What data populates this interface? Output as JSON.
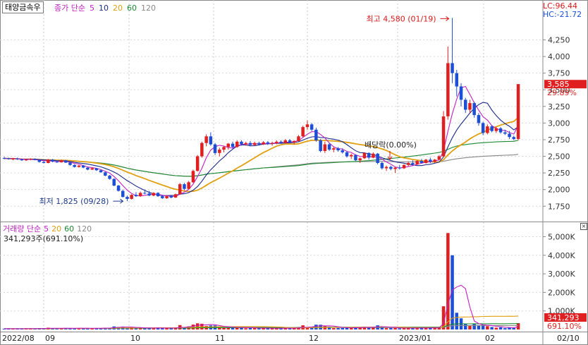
{
  "header": {
    "ticker": "태양금속우",
    "price_legend": {
      "label": "종가 단순",
      "ma5": "5",
      "ma10": "10",
      "ma20": "20",
      "ma60": "60",
      "ma120": "120"
    },
    "lc": "LC:96.44",
    "hc": "HC:-21.72"
  },
  "volume_legend": {
    "label": "거래량 단순",
    "ma5": "5",
    "ma20": "20",
    "ma60": "60",
    "ma120": "120",
    "info": "341,293주(691.10%)"
  },
  "colors": {
    "up": "#e02020",
    "down": "#1c4fd6",
    "ma5": "#c020c0",
    "ma10": "#1a2a8a",
    "ma20": "#e0a010",
    "ma60": "#1a8a30",
    "ma120": "#888888"
  },
  "chart_data": [
    {
      "type": "candlestick",
      "y_axis": {
        "ticks": [
          "4,250",
          "4,000",
          "3,750",
          "3,500",
          "3,250",
          "3,000",
          "2,750",
          "2,500",
          "2,250",
          "2,000",
          "1,750"
        ],
        "values": [
          4250,
          4000,
          3750,
          3500,
          3250,
          3000,
          2750,
          2500,
          2250,
          2000,
          1750
        ],
        "range": [
          1530,
          4680
        ]
      },
      "x_axis": {
        "labels": [
          "2022/08",
          "09",
          "10",
          "11",
          "12",
          "2023/01",
          "02",
          "02/10"
        ]
      },
      "annotations": {
        "high": "최고 4,580 (01/19)",
        "low": "최저 1,825 (09/28)",
        "dividend": "배당락(0.00%)"
      },
      "last_price": "3,585",
      "last_change": "29.89%",
      "series": [
        {
          "name": "5",
          "type": "moving-average"
        },
        {
          "name": "10",
          "type": "moving-average"
        },
        {
          "name": "20",
          "type": "moving-average"
        },
        {
          "name": "60",
          "type": "moving-average"
        },
        {
          "name": "120",
          "type": "moving-average"
        }
      ],
      "candles": [
        {
          "o": 2475,
          "h": 2490,
          "l": 2455,
          "c": 2470
        },
        {
          "o": 2470,
          "h": 2480,
          "l": 2450,
          "c": 2460
        },
        {
          "o": 2460,
          "h": 2475,
          "l": 2440,
          "c": 2465
        },
        {
          "o": 2465,
          "h": 2480,
          "l": 2445,
          "c": 2455
        },
        {
          "o": 2455,
          "h": 2465,
          "l": 2430,
          "c": 2440
        },
        {
          "o": 2440,
          "h": 2460,
          "l": 2430,
          "c": 2450
        },
        {
          "o": 2450,
          "h": 2470,
          "l": 2440,
          "c": 2460
        },
        {
          "o": 2460,
          "h": 2470,
          "l": 2440,
          "c": 2445
        },
        {
          "o": 2445,
          "h": 2450,
          "l": 2405,
          "c": 2415
        },
        {
          "o": 2415,
          "h": 2430,
          "l": 2395,
          "c": 2400
        },
        {
          "o": 2400,
          "h": 2460,
          "l": 2395,
          "c": 2450
        },
        {
          "o": 2450,
          "h": 2460,
          "l": 2410,
          "c": 2420
        },
        {
          "o": 2420,
          "h": 2430,
          "l": 2400,
          "c": 2410
        },
        {
          "o": 2410,
          "h": 2450,
          "l": 2405,
          "c": 2440
        },
        {
          "o": 2440,
          "h": 2445,
          "l": 2400,
          "c": 2405
        },
        {
          "o": 2405,
          "h": 2420,
          "l": 2360,
          "c": 2370
        },
        {
          "o": 2370,
          "h": 2380,
          "l": 2330,
          "c": 2340
        },
        {
          "o": 2340,
          "h": 2370,
          "l": 2330,
          "c": 2360
        },
        {
          "o": 2360,
          "h": 2370,
          "l": 2320,
          "c": 2330
        },
        {
          "o": 2330,
          "h": 2335,
          "l": 2290,
          "c": 2300
        },
        {
          "o": 2300,
          "h": 2330,
          "l": 2295,
          "c": 2320
        },
        {
          "o": 2320,
          "h": 2325,
          "l": 2280,
          "c": 2290
        },
        {
          "o": 2290,
          "h": 2300,
          "l": 2250,
          "c": 2260
        },
        {
          "o": 2260,
          "h": 2270,
          "l": 2200,
          "c": 2210
        },
        {
          "o": 2210,
          "h": 2220,
          "l": 2150,
          "c": 2160
        },
        {
          "o": 2160,
          "h": 2170,
          "l": 2050,
          "c": 2060
        },
        {
          "o": 2060,
          "h": 2070,
          "l": 1970,
          "c": 1980
        },
        {
          "o": 1980,
          "h": 2000,
          "l": 1880,
          "c": 1890
        },
        {
          "o": 1890,
          "h": 1910,
          "l": 1825,
          "c": 1860
        },
        {
          "o": 1860,
          "h": 1930,
          "l": 1850,
          "c": 1920
        },
        {
          "o": 1920,
          "h": 1960,
          "l": 1890,
          "c": 1900
        },
        {
          "o": 1900,
          "h": 1970,
          "l": 1890,
          "c": 1950
        },
        {
          "o": 1950,
          "h": 2000,
          "l": 1930,
          "c": 1940
        },
        {
          "o": 1940,
          "h": 1980,
          "l": 1900,
          "c": 1910
        },
        {
          "o": 1910,
          "h": 1960,
          "l": 1900,
          "c": 1950
        },
        {
          "o": 1950,
          "h": 1960,
          "l": 1890,
          "c": 1900
        },
        {
          "o": 1900,
          "h": 1920,
          "l": 1860,
          "c": 1870
        },
        {
          "o": 1870,
          "h": 1910,
          "l": 1860,
          "c": 1900
        },
        {
          "o": 1900,
          "h": 1920,
          "l": 1870,
          "c": 1880
        },
        {
          "o": 1880,
          "h": 1940,
          "l": 1875,
          "c": 1930
        },
        {
          "o": 1930,
          "h": 2100,
          "l": 1920,
          "c": 2080
        },
        {
          "o": 2080,
          "h": 2100,
          "l": 1990,
          "c": 2010
        },
        {
          "o": 2010,
          "h": 2130,
          "l": 2000,
          "c": 2110
        },
        {
          "o": 2110,
          "h": 2300,
          "l": 2100,
          "c": 2280
        },
        {
          "o": 2280,
          "h": 2520,
          "l": 2270,
          "c": 2500
        },
        {
          "o": 2500,
          "h": 2720,
          "l": 2480,
          "c": 2700
        },
        {
          "o": 2700,
          "h": 2830,
          "l": 2650,
          "c": 2800
        },
        {
          "o": 2800,
          "h": 2860,
          "l": 2660,
          "c": 2680
        },
        {
          "o": 2680,
          "h": 2700,
          "l": 2520,
          "c": 2550
        },
        {
          "o": 2550,
          "h": 2630,
          "l": 2500,
          "c": 2600
        },
        {
          "o": 2600,
          "h": 2660,
          "l": 2560,
          "c": 2640
        },
        {
          "o": 2640,
          "h": 2700,
          "l": 2600,
          "c": 2690
        },
        {
          "o": 2690,
          "h": 2720,
          "l": 2620,
          "c": 2640
        },
        {
          "o": 2640,
          "h": 2740,
          "l": 2630,
          "c": 2720
        },
        {
          "o": 2720,
          "h": 2740,
          "l": 2660,
          "c": 2680
        },
        {
          "o": 2680,
          "h": 2720,
          "l": 2660,
          "c": 2700
        },
        {
          "o": 2700,
          "h": 2730,
          "l": 2650,
          "c": 2670
        },
        {
          "o": 2670,
          "h": 2720,
          "l": 2660,
          "c": 2700
        },
        {
          "o": 2700,
          "h": 2720,
          "l": 2660,
          "c": 2680
        },
        {
          "o": 2680,
          "h": 2730,
          "l": 2670,
          "c": 2710
        },
        {
          "o": 2710,
          "h": 2730,
          "l": 2670,
          "c": 2690
        },
        {
          "o": 2690,
          "h": 2720,
          "l": 2660,
          "c": 2700
        },
        {
          "o": 2700,
          "h": 2740,
          "l": 2680,
          "c": 2720
        },
        {
          "o": 2720,
          "h": 2740,
          "l": 2690,
          "c": 2700
        },
        {
          "o": 2700,
          "h": 2760,
          "l": 2690,
          "c": 2740
        },
        {
          "o": 2740,
          "h": 2760,
          "l": 2700,
          "c": 2710
        },
        {
          "o": 2710,
          "h": 2740,
          "l": 2680,
          "c": 2730
        },
        {
          "o": 2730,
          "h": 2820,
          "l": 2720,
          "c": 2800
        },
        {
          "o": 2800,
          "h": 2960,
          "l": 2790,
          "c": 2940
        },
        {
          "o": 2940,
          "h": 3040,
          "l": 2900,
          "c": 2980
        },
        {
          "o": 2980,
          "h": 3000,
          "l": 2880,
          "c": 2900
        },
        {
          "o": 2900,
          "h": 2930,
          "l": 2720,
          "c": 2740
        },
        {
          "o": 2740,
          "h": 2760,
          "l": 2560,
          "c": 2580
        },
        {
          "o": 2580,
          "h": 2720,
          "l": 2550,
          "c": 2680
        },
        {
          "o": 2680,
          "h": 2700,
          "l": 2580,
          "c": 2600
        },
        {
          "o": 2600,
          "h": 2640,
          "l": 2560,
          "c": 2620
        },
        {
          "o": 2620,
          "h": 2640,
          "l": 2570,
          "c": 2590
        },
        {
          "o": 2590,
          "h": 2620,
          "l": 2540,
          "c": 2560
        },
        {
          "o": 2560,
          "h": 2580,
          "l": 2480,
          "c": 2500
        },
        {
          "o": 2500,
          "h": 2540,
          "l": 2460,
          "c": 2520
        },
        {
          "o": 2520,
          "h": 2530,
          "l": 2430,
          "c": 2440
        },
        {
          "o": 2440,
          "h": 2480,
          "l": 2400,
          "c": 2470
        },
        {
          "o": 2470,
          "h": 2560,
          "l": 2460,
          "c": 2550
        },
        {
          "o": 2550,
          "h": 2560,
          "l": 2450,
          "c": 2480
        },
        {
          "o": 2480,
          "h": 2560,
          "l": 2470,
          "c": 2540
        },
        {
          "o": 2540,
          "h": 2550,
          "l": 2380,
          "c": 2400
        },
        {
          "o": 2400,
          "h": 2420,
          "l": 2300,
          "c": 2320
        },
        {
          "o": 2320,
          "h": 2360,
          "l": 2280,
          "c": 2340
        },
        {
          "o": 2340,
          "h": 2360,
          "l": 2290,
          "c": 2310
        },
        {
          "o": 2310,
          "h": 2340,
          "l": 2250,
          "c": 2330
        },
        {
          "o": 2330,
          "h": 2370,
          "l": 2300,
          "c": 2320
        },
        {
          "o": 2320,
          "h": 2380,
          "l": 2310,
          "c": 2370
        },
        {
          "o": 2370,
          "h": 2420,
          "l": 2350,
          "c": 2400
        },
        {
          "o": 2400,
          "h": 2440,
          "l": 2360,
          "c": 2380
        },
        {
          "o": 2380,
          "h": 2440,
          "l": 2370,
          "c": 2430
        },
        {
          "o": 2430,
          "h": 2460,
          "l": 2390,
          "c": 2400
        },
        {
          "o": 2400,
          "h": 2460,
          "l": 2390,
          "c": 2450
        },
        {
          "o": 2450,
          "h": 2480,
          "l": 2400,
          "c": 2420
        },
        {
          "o": 2420,
          "h": 2460,
          "l": 2400,
          "c": 2450
        },
        {
          "o": 2450,
          "h": 2520,
          "l": 2440,
          "c": 2500
        },
        {
          "o": 2500,
          "h": 3180,
          "l": 2490,
          "c": 3100
        },
        {
          "o": 3100,
          "h": 4150,
          "l": 3050,
          "c": 3900
        },
        {
          "o": 3900,
          "h": 4580,
          "l": 3600,
          "c": 3750
        },
        {
          "o": 3750,
          "h": 3800,
          "l": 3400,
          "c": 3550
        },
        {
          "o": 3550,
          "h": 3600,
          "l": 3250,
          "c": 3350
        },
        {
          "o": 3350,
          "h": 3380,
          "l": 3150,
          "c": 3200
        },
        {
          "o": 3200,
          "h": 3350,
          "l": 3150,
          "c": 3300
        },
        {
          "o": 3300,
          "h": 3320,
          "l": 3080,
          "c": 3120
        },
        {
          "o": 3120,
          "h": 3150,
          "l": 2960,
          "c": 3000
        },
        {
          "o": 3000,
          "h": 3020,
          "l": 2820,
          "c": 2850
        },
        {
          "o": 2850,
          "h": 2980,
          "l": 2830,
          "c": 2950
        },
        {
          "o": 2950,
          "h": 2970,
          "l": 2860,
          "c": 2880
        },
        {
          "o": 2880,
          "h": 2940,
          "l": 2850,
          "c": 2920
        },
        {
          "o": 2920,
          "h": 2940,
          "l": 2840,
          "c": 2860
        },
        {
          "o": 2860,
          "h": 2900,
          "l": 2820,
          "c": 2840
        },
        {
          "o": 2840,
          "h": 2880,
          "l": 2760,
          "c": 2790
        },
        {
          "o": 2790,
          "h": 2810,
          "l": 2740,
          "c": 2760
        },
        {
          "o": 2760,
          "h": 3585,
          "l": 2740,
          "c": 3585
        }
      ]
    },
    {
      "type": "bar",
      "name": "거래량",
      "y_axis": {
        "ticks": [
          "5,000K",
          "4,000K",
          "3,000K",
          "2,000K",
          "1,000K"
        ],
        "values": [
          5000,
          4000,
          3000,
          2000,
          1000
        ],
        "unit": "K"
      },
      "last_value": "341,293",
      "last_ratio": "691.10%"
    }
  ]
}
